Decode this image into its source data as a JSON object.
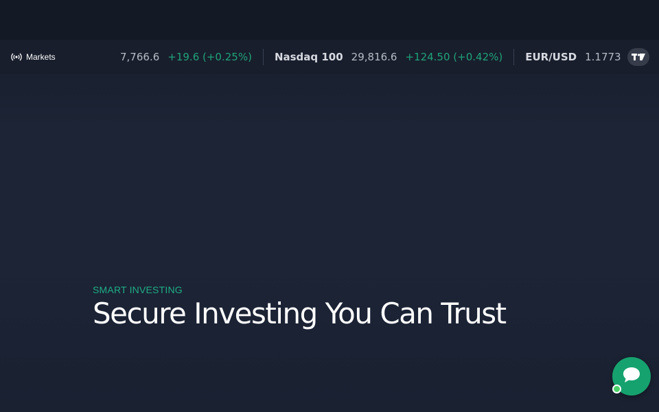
{
  "ticker": {
    "label": "Markets",
    "items": [
      {
        "symbol": "",
        "price": "7,766.6",
        "change": "+19.6 (+0.25%)"
      },
      {
        "symbol": "Nasdaq 100",
        "price": "29,816.6",
        "change": "+124.50 (+0.42%)"
      },
      {
        "symbol": "EUR/USD",
        "price": "1.1773",
        "change": ""
      }
    ],
    "badge": "TV",
    "colors": {
      "positive": "#1fa37a",
      "symbol": "#d6d9e0",
      "price": "#b7bcc6"
    }
  },
  "hero": {
    "eyebrow": "SMART INVESTING",
    "title": "Secure Investing You Can Trust",
    "eyebrow_color": "#1fae86"
  },
  "chat": {
    "icon": "chat-bubble-icon",
    "status": "online",
    "color": "#16a26f"
  }
}
